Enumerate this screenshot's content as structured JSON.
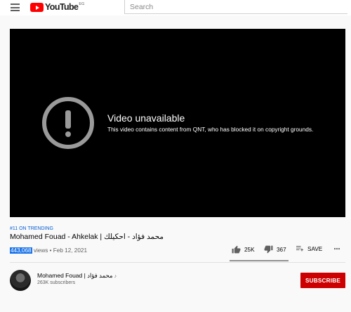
{
  "header": {
    "logo_text": "YouTube",
    "logo_region": "EG",
    "search_placeholder": "Search"
  },
  "player": {
    "error_title": "Video unavailable",
    "error_message": "This video contains content from QNT, who has blocked it on copyright grounds."
  },
  "video": {
    "trending": "#11 ON TRENDING",
    "title": "Mohamed Fouad - Ahkelak | محمد فؤاد - احكيلك",
    "views": "443,068",
    "views_suffix": " views • Feb 12, 2021"
  },
  "actions": {
    "like_count": "25K",
    "dislike_count": "367",
    "save_label": "SAVE"
  },
  "channel": {
    "name": "Mohamed Fouad | محمد فؤاد",
    "subscribers": "263K subscribers",
    "subscribe_label": "SUBSCRIBE"
  },
  "colors": {
    "brand_red": "#ff0000",
    "subscribe_red": "#cc0000",
    "link_blue": "#065fd4",
    "highlight_blue": "#1a73e8"
  },
  "icons": [
    "menu-icon",
    "youtube-logo-icon",
    "error-icon",
    "thumbs-up-icon",
    "thumbs-down-icon",
    "save-playlist-icon",
    "more-icon",
    "music-note-icon"
  ]
}
